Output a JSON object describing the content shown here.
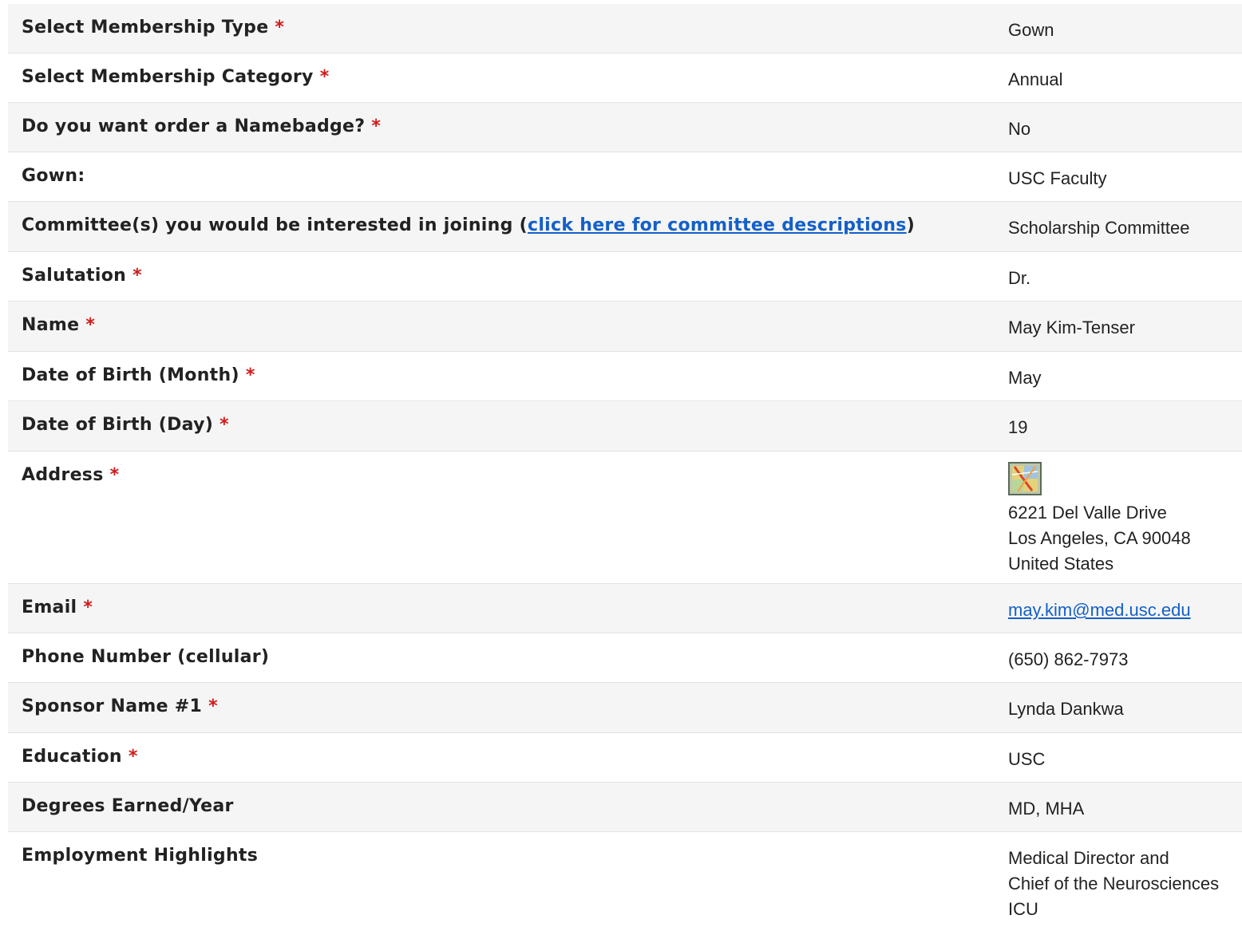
{
  "fields": [
    {
      "label": "Select Membership Type",
      "required": "*",
      "value": "Gown"
    },
    {
      "label": "Select Membership Category",
      "required": "*",
      "value": "Annual"
    },
    {
      "label": "Do you want order a Namebadge?",
      "required": "*",
      "value": "No"
    },
    {
      "label": "Gown:",
      "value": "USC Faculty"
    },
    {
      "label_prefix": "Committee(s) you would be interested in joining (",
      "link_text": "click here for committee descriptions",
      "label_suffix": ")",
      "value": "Scholarship Committee"
    },
    {
      "label": "Salutation",
      "required": "*",
      "value": "Dr."
    },
    {
      "label": "Name",
      "required": "*",
      "value": "May Kim-Tenser"
    },
    {
      "label": "Date of Birth (Month)",
      "required": "*",
      "value": "May"
    },
    {
      "label": "Date of Birth (Day)",
      "required": "*",
      "value": "19"
    },
    {
      "label": "Address",
      "required": "*",
      "map_icon": "map-icon",
      "lines": [
        "6221 Del Valle Drive",
        "Los Angeles, CA 90048",
        "United States"
      ]
    },
    {
      "label": "Email",
      "required": "*",
      "value": "may.kim@med.usc.edu"
    },
    {
      "label": "Phone Number (cellular)",
      "value": "(650) 862-7973"
    },
    {
      "label": "Sponsor Name #1",
      "required": "*",
      "value": "Lynda Dankwa"
    },
    {
      "label": "Education",
      "required": "*",
      "value": "USC"
    },
    {
      "label": "Degrees Earned/Year",
      "value": "MD, MHA"
    },
    {
      "label": "Employment Highlights",
      "lines": [
        "Medical Director and",
        "Chief of the Neurosciences",
        "ICU"
      ]
    }
  ],
  "colors": {
    "required": "#d11a1a",
    "link": "#1460c8",
    "row_alt": "#f5f5f5"
  }
}
